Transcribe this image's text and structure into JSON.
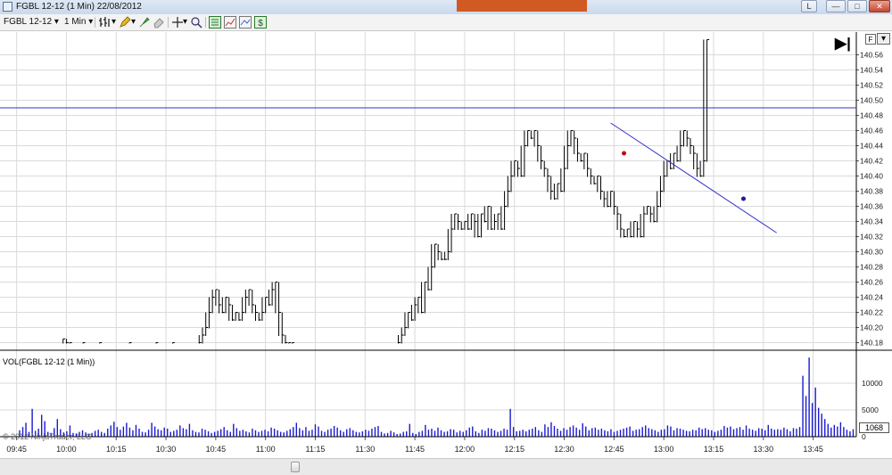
{
  "window": {
    "title": "FGBL 12-12 (1 Min)  22/08/2012",
    "buttons": {
      "layout": "L",
      "minimize": "—",
      "maximize": "□",
      "close": "✕"
    }
  },
  "toolbar": {
    "instrument": "FGBL 12-12",
    "interval": "1 Min",
    "dropdown_arrow": "▾",
    "icons": [
      "bar-type-icon",
      "drawing-pencil-icon",
      "drawing-marker-icon",
      "eraser-icon",
      "crosshair-icon",
      "zoom-icon",
      "chart-properties-icon",
      "indicators-icon",
      "strategies-icon",
      "dollar-icon"
    ]
  },
  "chart": {
    "right_buttons": {
      "f_label": "F",
      "dropdown": "▾"
    },
    "end_button_label": "▶|",
    "volume_panel_label": "VOL(FGBL 12-12 (1 Min))",
    "volume_badge": "1068",
    "copyright": "© 2012 NinjaTrader, LLC",
    "colors": {
      "price_bar": "#000000",
      "horizontal_line": "#3333cc",
      "trend_line": "#3333cc",
      "volume": "#1a1ad0",
      "red_marker": "#cc0000",
      "blue_marker": "#1a1aa0"
    }
  },
  "chart_data": [
    {
      "type": "line",
      "ylim": [
        140.17,
        140.59
      ],
      "y_ticks": [
        "140.56",
        "140.54",
        "140.52",
        "140.50",
        "140.48",
        "140.46",
        "140.44",
        "140.42",
        "140.40",
        "140.38",
        "140.36",
        "140.34",
        "140.32",
        "140.30",
        "140.28",
        "140.26",
        "140.24",
        "140.22",
        "140.20",
        "140.18"
      ],
      "x_ticks": [
        "09:45",
        "10:00",
        "10:15",
        "10:30",
        "10:45",
        "11:00",
        "11:15",
        "11:30",
        "11:45",
        "12:00",
        "12:15",
        "12:30",
        "12:45",
        "13:00",
        "13:15",
        "13:30",
        "13:45"
      ],
      "horizontal_line": 140.49,
      "trend_line": {
        "from": [
          "12:44",
          140.47
        ],
        "to": [
          "13:34",
          140.325
        ]
      },
      "markers": [
        {
          "color": "red",
          "time": "12:48",
          "value": 140.43
        },
        {
          "color": "blue",
          "time": "13:24",
          "value": 140.37
        }
      ],
      "series": [
        {
          "values": [
            [
              "09:59",
              140.185
            ],
            [
              "10:00",
              140.18
            ],
            [
              "10:01",
              140.18
            ],
            [
              "10:05",
              140.18
            ],
            [
              "10:10",
              140.18
            ],
            [
              "10:19",
              140.18
            ],
            [
              "10:27",
              140.18
            ],
            [
              "10:32",
              140.18
            ],
            [
              "10:40",
              140.18
            ],
            [
              "10:41",
              140.19
            ],
            [
              "10:42",
              140.2
            ],
            [
              "10:43",
              140.22
            ],
            [
              "10:44",
              140.24
            ],
            [
              "10:45",
              140.25
            ],
            [
              "10:46",
              140.23
            ],
            [
              "10:47",
              140.22
            ],
            [
              "10:48",
              140.24
            ],
            [
              "10:49",
              140.23
            ],
            [
              "10:50",
              140.21
            ],
            [
              "10:51",
              140.22
            ],
            [
              "10:52",
              140.21
            ],
            [
              "10:53",
              140.22
            ],
            [
              "10:54",
              140.24
            ],
            [
              "10:55",
              140.25
            ],
            [
              "10:56",
              140.23
            ],
            [
              "10:57",
              140.22
            ],
            [
              "10:58",
              140.21
            ],
            [
              "10:59",
              140.22
            ],
            [
              "11:00",
              140.24
            ],
            [
              "11:01",
              140.23
            ],
            [
              "11:02",
              140.25
            ],
            [
              "11:03",
              140.26
            ],
            [
              "11:04",
              140.22
            ],
            [
              "11:05",
              140.19
            ],
            [
              "11:06",
              140.18
            ],
            [
              "11:07",
              140.18
            ],
            [
              "11:08",
              140.18
            ],
            [
              "11:40",
              140.18
            ],
            [
              "11:41",
              140.19
            ],
            [
              "11:42",
              140.2
            ],
            [
              "11:43",
              140.22
            ],
            [
              "11:44",
              140.21
            ],
            [
              "11:45",
              140.23
            ],
            [
              "11:46",
              140.24
            ],
            [
              "11:47",
              140.22
            ],
            [
              "11:48",
              140.26
            ],
            [
              "11:49",
              140.25
            ],
            [
              "11:50",
              140.28
            ],
            [
              "11:51",
              140.31
            ],
            [
              "11:52",
              140.3
            ],
            [
              "11:53",
              140.29
            ],
            [
              "11:54",
              140.29
            ],
            [
              "11:55",
              140.3
            ],
            [
              "11:56",
              140.33
            ],
            [
              "11:57",
              140.35
            ],
            [
              "11:58",
              140.34
            ],
            [
              "11:59",
              140.33
            ],
            [
              "12:00",
              140.34
            ],
            [
              "12:01",
              140.33
            ],
            [
              "12:02",
              140.35
            ],
            [
              "12:03",
              140.34
            ],
            [
              "12:04",
              140.32
            ],
            [
              "12:05",
              140.35
            ],
            [
              "12:06",
              140.34
            ],
            [
              "12:07",
              140.36
            ],
            [
              "12:08",
              140.33
            ],
            [
              "12:09",
              140.34
            ],
            [
              "12:10",
              140.35
            ],
            [
              "12:11",
              140.33
            ],
            [
              "12:12",
              140.36
            ],
            [
              "12:13",
              140.38
            ],
            [
              "12:14",
              140.4
            ],
            [
              "12:15",
              140.42
            ],
            [
              "12:16",
              140.41
            ],
            [
              "12:17",
              140.4
            ],
            [
              "12:18",
              140.44
            ],
            [
              "12:19",
              140.46
            ],
            [
              "12:20",
              140.45
            ],
            [
              "12:21",
              140.46
            ],
            [
              "12:22",
              140.44
            ],
            [
              "12:23",
              140.42
            ],
            [
              "12:24",
              140.41
            ],
            [
              "12:25",
              140.4
            ],
            [
              "12:26",
              140.38
            ],
            [
              "12:27",
              140.37
            ],
            [
              "12:28",
              140.39
            ],
            [
              "12:29",
              140.38
            ],
            [
              "12:30",
              140.41
            ],
            [
              "12:31",
              140.44
            ],
            [
              "12:32",
              140.46
            ],
            [
              "12:33",
              140.45
            ],
            [
              "12:34",
              140.43
            ],
            [
              "12:35",
              140.42
            ],
            [
              "12:36",
              140.43
            ],
            [
              "12:37",
              140.41
            ],
            [
              "12:38",
              140.4
            ],
            [
              "12:39",
              140.39
            ],
            [
              "12:40",
              140.4
            ],
            [
              "12:41",
              140.38
            ],
            [
              "12:42",
              140.37
            ],
            [
              "12:43",
              140.36
            ],
            [
              "12:44",
              140.38
            ],
            [
              "12:45",
              140.36
            ],
            [
              "12:46",
              140.35
            ],
            [
              "12:47",
              140.33
            ],
            [
              "12:48",
              140.32
            ],
            [
              "12:49",
              140.33
            ],
            [
              "12:50",
              140.32
            ],
            [
              "12:51",
              140.34
            ],
            [
              "12:52",
              140.33
            ],
            [
              "12:53",
              140.32
            ],
            [
              "12:54",
              140.35
            ],
            [
              "12:55",
              140.36
            ],
            [
              "12:56",
              140.35
            ],
            [
              "12:57",
              140.34
            ],
            [
              "12:58",
              140.36
            ],
            [
              "12:59",
              140.38
            ],
            [
              "13:00",
              140.4
            ],
            [
              "13:01",
              140.42
            ],
            [
              "13:02",
              140.41
            ],
            [
              "13:03",
              140.43
            ],
            [
              "13:04",
              140.42
            ],
            [
              "13:05",
              140.44
            ],
            [
              "13:06",
              140.46
            ],
            [
              "13:07",
              140.45
            ],
            [
              "13:08",
              140.44
            ],
            [
              "13:09",
              140.43
            ],
            [
              "13:10",
              140.41
            ],
            [
              "13:11",
              140.4
            ],
            [
              "13:12",
              140.42
            ],
            [
              "13:13",
              140.58
            ]
          ]
        }
      ]
    },
    {
      "type": "bar",
      "ylim": [
        0,
        15000
      ],
      "y_ticks": [
        "10000",
        "5000",
        "0"
      ],
      "series": [
        {
          "name": "VOL(FGBL 12-12 (1 Min))",
          "values": [
            1200,
            1800,
            2600,
            900,
            5200,
            1100,
            1500,
            4100,
            2900,
            900,
            700,
            1600,
            3300,
            1400,
            800,
            1000,
            2100,
            700,
            600,
            900,
            1200,
            800,
            500,
            700,
            1100,
            1300,
            900,
            700,
            1500,
            2100,
            2800,
            1800,
            1300,
            1900,
            2600,
            1700,
            1200,
            2200,
            1500,
            900,
            800,
            1300,
            2600,
            1900,
            1400,
            1200,
            1700,
            1500,
            900,
            1100,
            1300,
            2100,
            1600,
            1400,
            2400,
            1200,
            900,
            800,
            1500,
            1300,
            1000,
            700,
            900,
            1100,
            1400,
            1800,
            1200,
            900,
            2400,
            1600,
            1100,
            1300,
            1000,
            800,
            1500,
            1200,
            900,
            1100,
            1300,
            1000,
            1700,
            1500,
            1200,
            900,
            800,
            1100,
            1400,
            1800,
            2600,
            1600,
            1200,
            1800,
            1100,
            1300,
            2300,
            1900,
            1100,
            900,
            1300,
            1500,
            2000,
            1700,
            1200,
            900,
            1400,
            1600,
            1200,
            900,
            800,
            1000,
            1300,
            1100,
            1500,
            1800,
            2000,
            900,
            600,
            700,
            1100,
            800,
            500,
            600,
            900,
            1000,
            2400,
            700,
            500,
            900,
            1100,
            2200,
            1300,
            1500,
            1100,
            1700,
            1200,
            900,
            1000,
            1400,
            1300,
            800,
            1100,
            900,
            1200,
            1700,
            1900,
            1000,
            700,
            1300,
            1100,
            1600,
            1500,
            1200,
            900,
            1100,
            1500,
            1300,
            5200,
            1800,
            1000,
            1100,
            1300,
            1000,
            1300,
            1500,
            1800,
            1200,
            900,
            2300,
            1800,
            2700,
            2000,
            1500,
            1100,
            1600,
            1300,
            1800,
            2100,
            1700,
            1300,
            2500,
            1900,
            1200,
            1600,
            1700,
            1300,
            1500,
            1200,
            1000,
            1400,
            900,
            1100,
            1300,
            1500,
            1700,
            1900,
            1100,
            1300,
            1400,
            1800,
            2100,
            1600,
            1400,
            1200,
            900,
            1300,
            1400,
            2100,
            1900,
            1200,
            1600,
            1500,
            1300,
            1100,
            1000,
            1300,
            1200,
            1700,
            1400,
            1600,
            1300,
            1200,
            900,
            1100,
            1300,
            2000,
            1700,
            1900,
            1400,
            1600,
            1800,
            1300,
            2100,
            1500,
            1300,
            1100,
            1600,
            1500,
            1200,
            2200,
            1500,
            1300,
            1400,
            1300,
            1700,
            1400,
            1000,
            1600,
            1500,
            1800,
            11400,
            7600,
            14800,
            6300,
            9200,
            5400,
            4300,
            3300,
            2400,
            1700,
            2200,
            1900,
            2700,
            1800,
            1300,
            1000,
            1400
          ]
        }
      ]
    }
  ]
}
